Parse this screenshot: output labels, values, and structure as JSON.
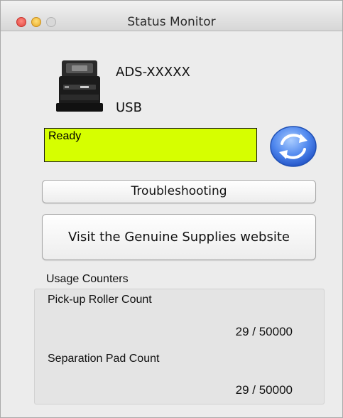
{
  "window": {
    "title": "Status Monitor"
  },
  "device": {
    "model": "ADS-XXXXX",
    "connection": "USB",
    "icon": "scanner-icon"
  },
  "status": {
    "text": "Ready",
    "color": "#d6ff00"
  },
  "buttons": {
    "refresh_icon": "refresh-icon",
    "troubleshooting": "Troubleshooting",
    "supplies": "Visit the Genuine Supplies website"
  },
  "usage": {
    "label": "Usage Counters",
    "counters": [
      {
        "name": "Pick-up Roller Count",
        "value": "29 / 50000"
      },
      {
        "name": "Separation Pad Count",
        "value": "29 / 50000"
      }
    ]
  }
}
